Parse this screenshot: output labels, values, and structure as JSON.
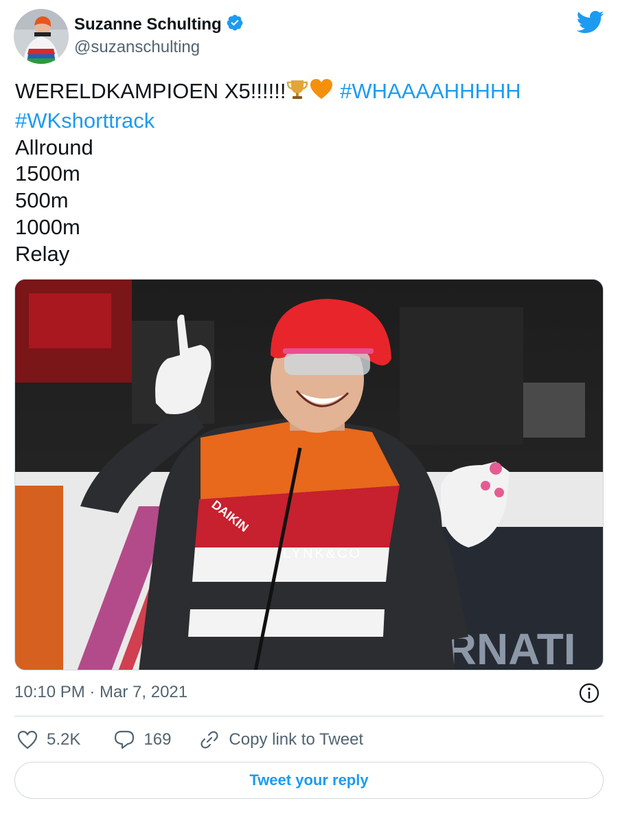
{
  "author": {
    "name": "Suzanne Schulting",
    "handle": "@suzanschulting",
    "verified": true
  },
  "tweet": {
    "lines": [
      {
        "text": "WERELDKAMPIOEN X5!!!!!!",
        "hashtag": "#WHAAAAHHHHH"
      },
      {
        "hashtag": "#WKshorttrack"
      },
      {
        "text": "Allround"
      },
      {
        "text": "1500m"
      },
      {
        "text": "500m"
      },
      {
        "text": "1000m"
      },
      {
        "text": "Relay"
      }
    ],
    "emojis": [
      "trophy-icon",
      "orange-heart-icon"
    ],
    "media": {
      "sponsor_text": "LYNK&CO",
      "sponsor_text_2": "DAIKIN",
      "banner_text": "INTERNATI"
    },
    "timestamp": "10:10 PM · Mar 7, 2021"
  },
  "actions": {
    "likes": "5.2K",
    "replies": "169",
    "copy_link_label": "Copy link to Tweet"
  },
  "reply_button_label": "Tweet your reply",
  "colors": {
    "accent": "#1d9bf0",
    "text": "#0f1419",
    "secondary": "#536471",
    "border": "#cfd9de"
  }
}
